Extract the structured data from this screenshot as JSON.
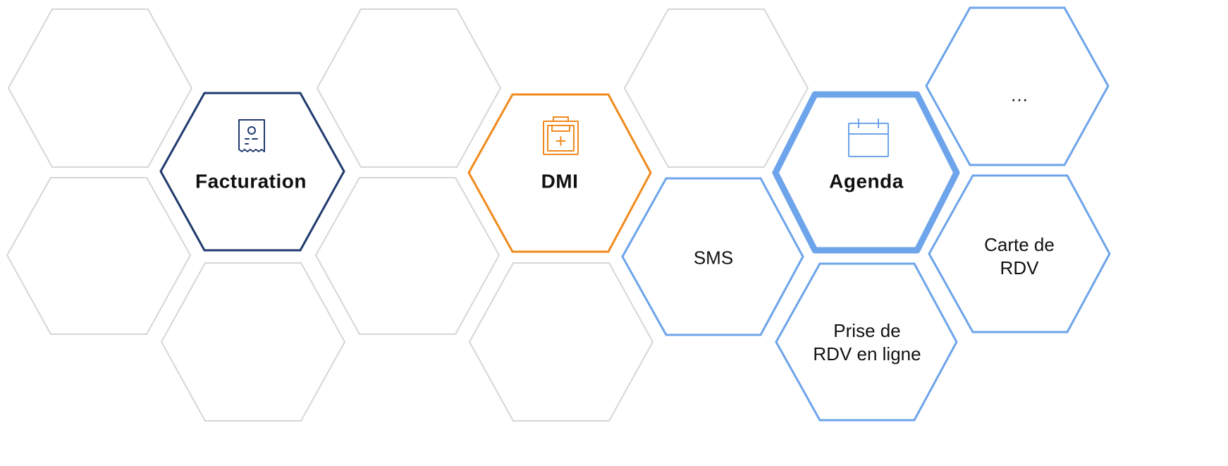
{
  "colors": {
    "grey": "#d6d6d6",
    "navy": "#1f3a6e",
    "orange": "#f08a1d",
    "blue": "#6da4ea"
  },
  "hexes": [
    {
      "id": "hex-grey-1",
      "style": "grey",
      "label": ""
    },
    {
      "id": "hex-grey-2",
      "style": "grey",
      "label": ""
    },
    {
      "id": "hex-grey-3",
      "style": "grey",
      "label": ""
    },
    {
      "id": "hex-grey-4",
      "style": "grey",
      "label": ""
    },
    {
      "id": "hex-grey-5",
      "style": "grey",
      "label": ""
    },
    {
      "id": "hex-grey-6",
      "style": "grey",
      "label": ""
    },
    {
      "id": "hex-grey-7",
      "style": "grey",
      "label": ""
    },
    {
      "id": "hex-grey-8",
      "style": "grey",
      "label": ""
    },
    {
      "id": "hex-facturation",
      "style": "navy",
      "label": "Facturation",
      "icon": "receipt-icon"
    },
    {
      "id": "hex-dmi",
      "style": "orange",
      "label": "DMI",
      "icon": "clipboard-medical-icon"
    },
    {
      "id": "hex-agenda",
      "style": "blue-thick",
      "label": "Agenda",
      "icon": "calendar-icon"
    },
    {
      "id": "hex-ellipsis",
      "style": "blue",
      "label": "…"
    },
    {
      "id": "hex-sms",
      "style": "blue",
      "label": "SMS"
    },
    {
      "id": "hex-carte",
      "style": "blue",
      "label": "Carte de\nRDV"
    },
    {
      "id": "hex-prise",
      "style": "blue",
      "label": "Prise de\nRDV en ligne"
    }
  ]
}
